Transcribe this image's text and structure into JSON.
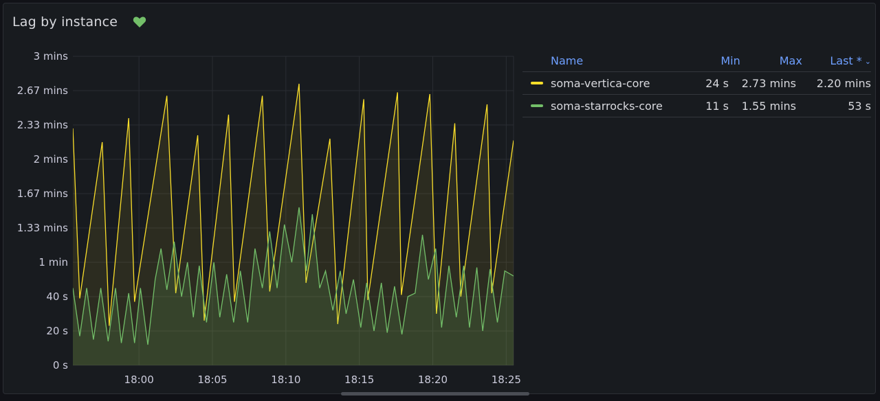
{
  "panel": {
    "title": "Lag by instance",
    "health_icon": "heart-icon",
    "health_color": "#73bf69"
  },
  "legend": {
    "headers": {
      "name": "Name",
      "min": "Min",
      "max": "Max",
      "last": "Last *"
    },
    "rows": [
      {
        "name": "soma-vertica-core",
        "color": "#fade2a",
        "min": "24 s",
        "max": "2.73 mins",
        "last": "2.20 mins"
      },
      {
        "name": "soma-starrocks-core",
        "color": "#73bf69",
        "min": "11 s",
        "max": "1.55 mins",
        "last": "53 s"
      }
    ]
  },
  "chart_data": {
    "type": "area",
    "y_tick_labels": [
      "0 s",
      "20 s",
      "40 s",
      "1 min",
      "1.33 mins",
      "1.67 mins",
      "2 mins",
      "2.33 mins",
      "2.67 mins",
      "3 mins"
    ],
    "y_tick_values": [
      0,
      20,
      40,
      60,
      80,
      100,
      120,
      140,
      160,
      180
    ],
    "x_tick_labels": [
      "18:00",
      "18:05",
      "18:10",
      "18:15",
      "18:20",
      "18:25"
    ],
    "x_tick_minutes": [
      1080,
      1085,
      1090,
      1095,
      1100,
      1105
    ],
    "xlim": [
      1075.5,
      1105.5
    ],
    "ylim": [
      0,
      180
    ],
    "grid": true,
    "series": [
      {
        "name": "soma-vertica-core",
        "color": "#fade2a",
        "x": [
          1075.5,
          1075.97,
          1077.5,
          1077.97,
          1079.3,
          1079.7,
          1081.9,
          1082.5,
          1084.0,
          1084.44,
          1086.1,
          1086.5,
          1088.4,
          1088.9,
          1090.9,
          1091.37,
          1093.0,
          1093.53,
          1095.3,
          1095.58,
          1097.6,
          1097.86,
          1099.8,
          1100.25,
          1101.5,
          1101.91,
          1103.7,
          1104.01,
          1105.5
        ],
        "y": [
          138,
          39,
          130,
          23,
          144,
          37,
          157,
          42,
          134,
          26,
          146,
          37,
          157,
          43,
          164,
          48,
          132,
          24,
          155,
          38,
          159,
          41,
          158,
          30,
          141,
          40,
          152,
          42,
          131
        ]
      },
      {
        "name": "soma-starrocks-core",
        "color": "#73bf69",
        "x": [
          1075.5,
          1075.97,
          1076.44,
          1076.9,
          1077.4,
          1077.9,
          1078.4,
          1078.8,
          1079.3,
          1079.7,
          1080.1,
          1080.6,
          1081.1,
          1081.5,
          1081.9,
          1082.4,
          1082.9,
          1083.3,
          1083.7,
          1084.1,
          1084.6,
          1085.1,
          1085.5,
          1085.97,
          1086.44,
          1086.9,
          1087.4,
          1087.9,
          1088.4,
          1088.9,
          1089.4,
          1089.9,
          1090.4,
          1090.9,
          1091.4,
          1091.8,
          1092.3,
          1092.7,
          1093.2,
          1093.7,
          1094.1,
          1094.6,
          1095.1,
          1095.5,
          1096.0,
          1096.5,
          1096.9,
          1097.4,
          1097.9,
          1098.3,
          1098.8,
          1099.3,
          1099.7,
          1100.2,
          1100.6,
          1101.1,
          1101.6,
          1102.1,
          1102.5,
          1103.0,
          1103.4,
          1103.9,
          1104.4,
          1104.9,
          1105.5
        ],
        "y": [
          45,
          17,
          45,
          15,
          45,
          14,
          45,
          13,
          42,
          13,
          45,
          12,
          50,
          68,
          44,
          72,
          40,
          60,
          28,
          58,
          25,
          60,
          28,
          53,
          25,
          55,
          25,
          68,
          45,
          78,
          45,
          82,
          60,
          92,
          55,
          88,
          45,
          55,
          32,
          55,
          30,
          50,
          22,
          48,
          20,
          48,
          19,
          46,
          18,
          40,
          42,
          76,
          50,
          68,
          22,
          58,
          28,
          58,
          22,
          57,
          20,
          56,
          25,
          55,
          52
        ]
      }
    ]
  }
}
